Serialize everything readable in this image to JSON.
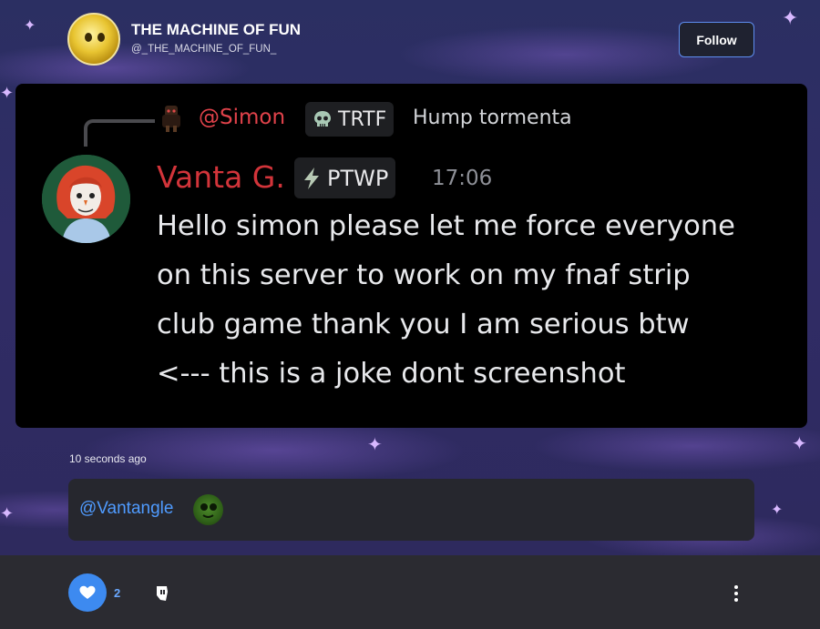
{
  "profile": {
    "name": "THE MACHINE OF FUN",
    "handle": "@_THE_MACHINE_OF_FUN_",
    "follow_label": "Follow"
  },
  "embed": {
    "reply": {
      "author": "@Simon",
      "badge_icon": "skull-icon",
      "badge_label": "TRTF",
      "text": "Hump tormenta"
    },
    "message": {
      "author": "Vanta G.",
      "badge_icon": "lightning-icon",
      "badge_label": "PTWP",
      "time": "17:06",
      "lines": [
        "Hello simon please let me force everyone",
        "on this server to work on my fnaf strip",
        "club game thank you I am serious btw",
        "<--- this is a joke dont screenshot"
      ]
    }
  },
  "post": {
    "timestamp": "10 seconds ago",
    "comment_mention": "@Vantangle",
    "like_count": "2"
  },
  "colors": {
    "accent": "#3d8af0",
    "mention": "#4f9bff",
    "reply_author": "#e0424a",
    "message_author": "#d2343a"
  }
}
